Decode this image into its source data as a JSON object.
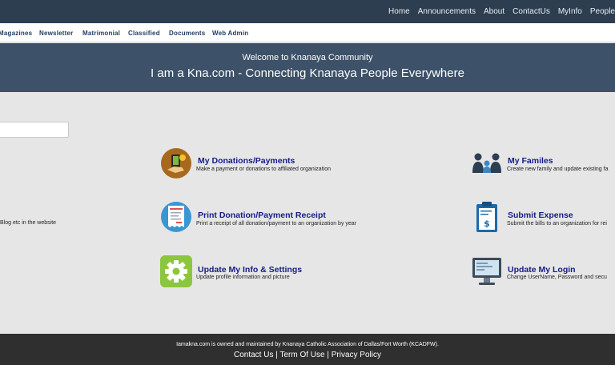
{
  "topnav": {
    "items": [
      "Home",
      "Announcements",
      "About",
      "ContactUs",
      "MyInfo",
      "People"
    ]
  },
  "subnav": {
    "items": [
      "Magazines",
      "Newsletter",
      "Matrimonial",
      "Classified",
      "Documents",
      "Web Admin"
    ]
  },
  "hero": {
    "welcome": "Welcome to Knanaya Community",
    "tagline": "I am a Kna.com - Connecting Knanaya People Everywhere"
  },
  "left_partial_text": "Blog etc in the website",
  "tiles": [
    {
      "title": "My Donations/Payments",
      "desc": "Make a payment or donations to affiliated organization",
      "icon": "hand-coin-icon"
    },
    {
      "title": "My Familes",
      "desc": "Create new family and update existing fa",
      "icon": "family-icon"
    },
    {
      "title": "Print Donation/Payment Receipt",
      "desc": "Print a receipt of all donation/payment to an organization by year",
      "icon": "receipt-icon"
    },
    {
      "title": "Submit Expense",
      "desc": "Submit the bills to an organization for rei",
      "icon": "expense-icon"
    },
    {
      "title": "Update My Info & Settings",
      "desc": "Update profile information and picture",
      "icon": "gear-icon"
    },
    {
      "title": "Update My Login",
      "desc": "Change UserName, Password and secu",
      "icon": "monitor-icon"
    }
  ],
  "footer": {
    "owner_text": "Iamakna.com is owned and maintained by Knanaya Catholic Association of Dallas/Fort Worth (KCADFW).",
    "contact": "Contact Us",
    "sep": "|",
    "terms": "Term Of Use",
    "privacy": "Privacy Policy"
  },
  "colors": {
    "topbar": "#2d3e50",
    "hero": "#3d5168",
    "title": "#141c86",
    "footer": "#2f2f2f"
  }
}
